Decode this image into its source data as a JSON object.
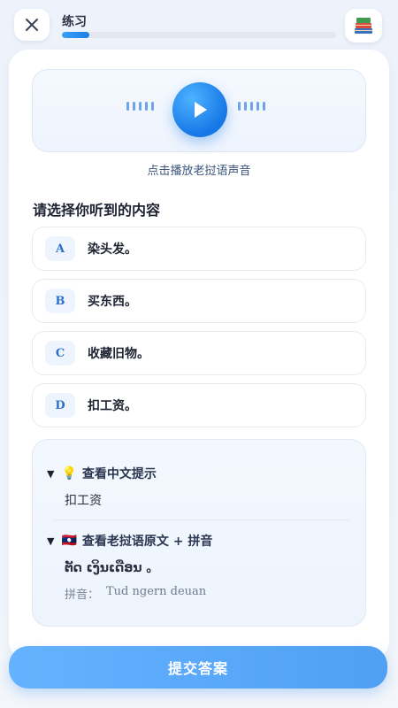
{
  "header": {
    "title": "练习",
    "progress_percent": 10,
    "close_icon": "close-icon",
    "books_icon": "books-icon"
  },
  "audio": {
    "hint": "点击播放老挝语声音"
  },
  "question": {
    "prompt": "请选择你听到的内容",
    "options": [
      {
        "letter": "A",
        "text": "染头发。"
      },
      {
        "letter": "B",
        "text": "买东西。"
      },
      {
        "letter": "C",
        "text": "收藏旧物。"
      },
      {
        "letter": "D",
        "text": "扣工资。"
      }
    ]
  },
  "hints": {
    "chinese": {
      "icon": "💡",
      "title": "查看中文提示",
      "content": "扣工资"
    },
    "lao": {
      "icon": "🇱🇦",
      "title": "查看老挝语原文 + 拼音",
      "content": "ຕັດ ເງິນເດືອນ 。",
      "pinyin_label": "拼音：",
      "pinyin": "Tud ngern deuan"
    }
  },
  "submit": {
    "label": "提交答案"
  },
  "colors": {
    "accent": "#1a7fe8",
    "submit": "#5aa8f8"
  }
}
